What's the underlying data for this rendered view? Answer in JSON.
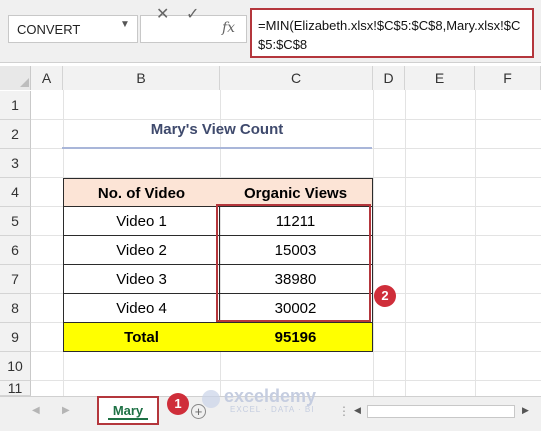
{
  "formula_bar": {
    "name_box": "CONVERT",
    "cancel_icon": "✕",
    "enter_icon": "✓",
    "fx_label": "fx",
    "formula": "=MIN(Elizabeth.xlsx!$C$5:$C$8,Mary.xlsx!$C$5:$C$8"
  },
  "columns": [
    "A",
    "B",
    "C",
    "D",
    "E",
    "F"
  ],
  "rows": [
    "1",
    "2",
    "3",
    "4",
    "5",
    "6",
    "7",
    "8",
    "9",
    "10",
    "11"
  ],
  "sheet_title": "Mary's View Count",
  "table": {
    "headers": [
      "No. of Video",
      "Organic Views"
    ],
    "rows": [
      [
        "Video 1",
        "11211"
      ],
      [
        "Video 2",
        "15003"
      ],
      [
        "Video 3",
        "38980"
      ],
      [
        "Video 4",
        "30002"
      ]
    ],
    "total": [
      "Total",
      "95196"
    ]
  },
  "annotations": {
    "badge_1": "1",
    "badge_2": "2"
  },
  "sheet_tabs": {
    "active": "Mary",
    "add": "+"
  },
  "watermark": {
    "name": "exceldemy",
    "tagline": "EXCEL · DATA · BI"
  },
  "colors": {
    "highlight_border": "#b4363c",
    "header_fill": "#fce4d6",
    "total_fill": "#ffff00",
    "tab_text": "#1e7145"
  }
}
